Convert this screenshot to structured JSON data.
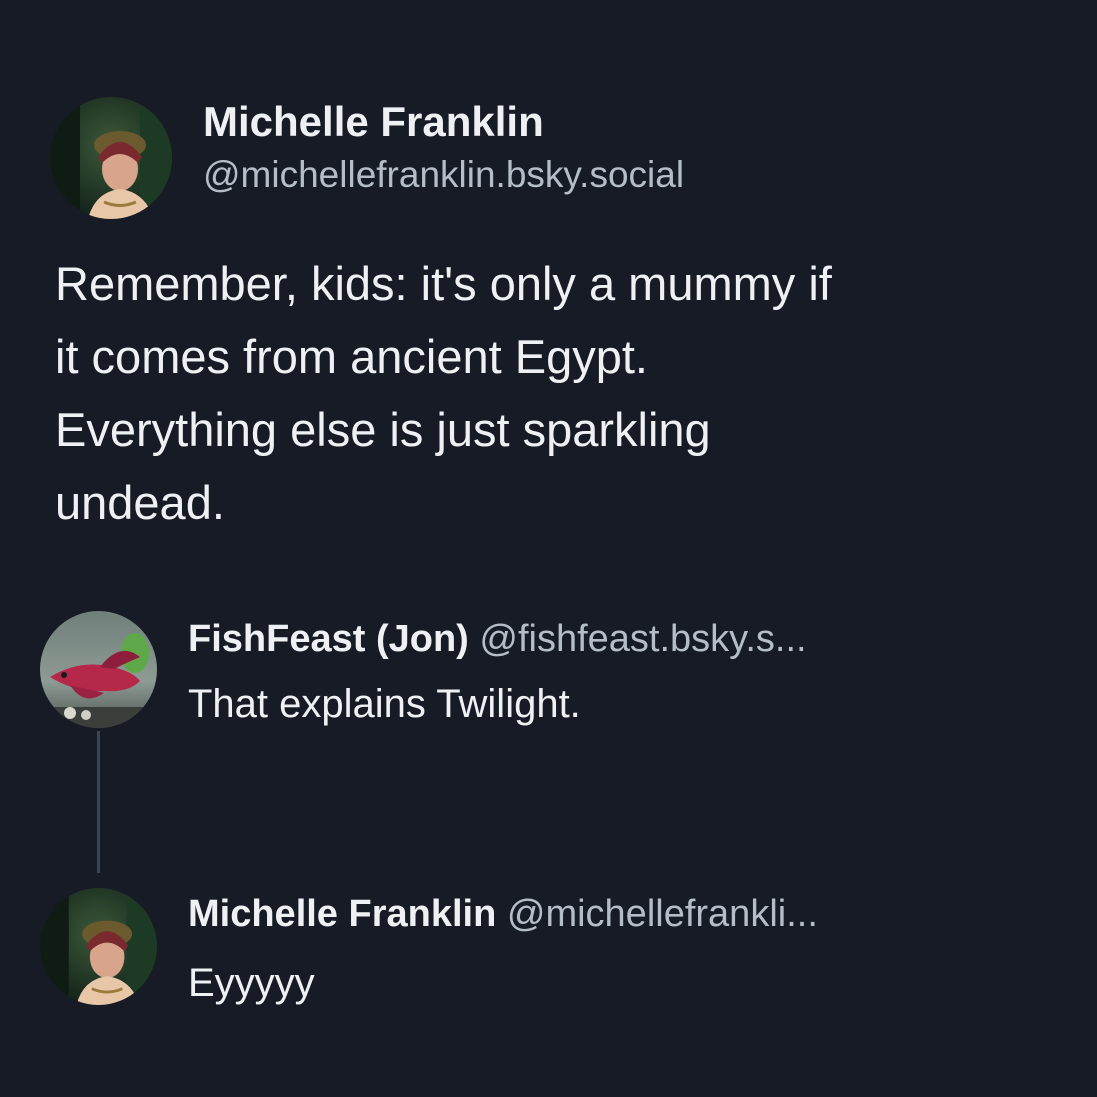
{
  "post": {
    "author_name": "Michelle Franklin",
    "author_handle": "@michellefranklin.bsky.social",
    "text_lines": [
      "Remember, kids: it's only a mummy if",
      "it comes from ancient Egypt.",
      "Everything else is just sparkling",
      "undead."
    ]
  },
  "replies": [
    {
      "author_name": "FishFeast (Jon)",
      "author_handle": "@fishfeast.bsky.s...",
      "text": "That explains Twilight.",
      "avatar_icon": "betta-fish-avatar"
    },
    {
      "author_name": "Michelle Franklin",
      "author_handle": "@michellefrankli...",
      "text": "Eyyyyy",
      "avatar_icon": "profile-photo-avatar"
    }
  ],
  "colors": {
    "background": "#161b25",
    "primary_text": "#eef0f4",
    "secondary_text": "#b5bdc9",
    "thread_line": "#3b4453"
  }
}
